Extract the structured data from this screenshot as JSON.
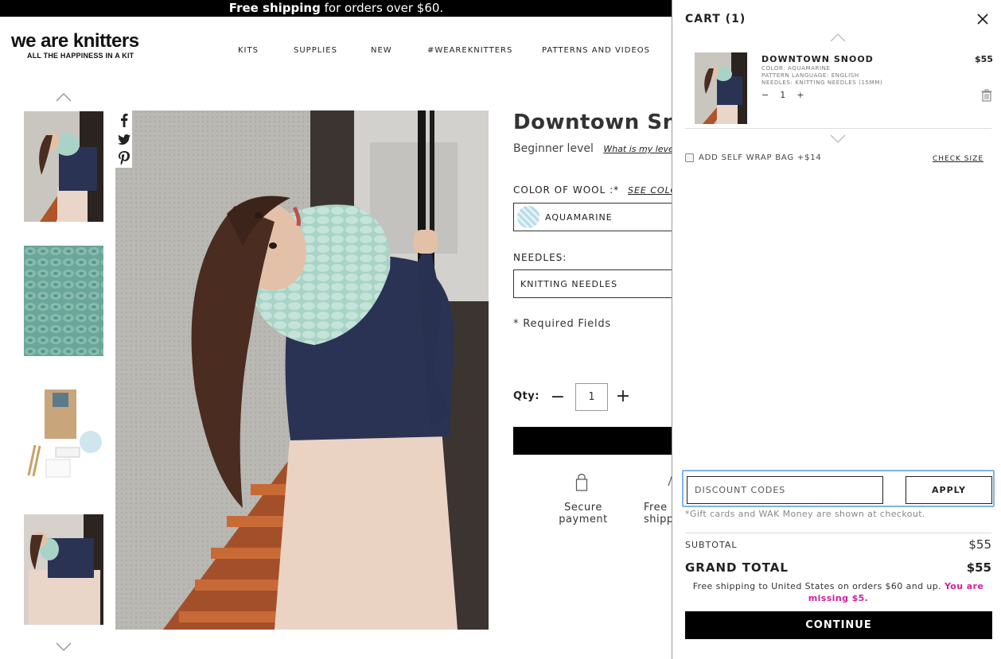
{
  "topbar": {
    "bold": "Free shipping",
    "rest": " for orders over $60."
  },
  "logo": {
    "main": "we are knitters",
    "tagline": "ALL THE HAPPINESS IN A KIT"
  },
  "nav": {
    "items": [
      "KITS",
      "SUPPLIES",
      "NEW",
      "#WEAREKNITTERS",
      "PATTERNS AND VIDEOS"
    ]
  },
  "product": {
    "title": "Downtown Snood",
    "level": "Beginner level",
    "level_link": "What is my level?",
    "color_label": "COLOR OF WOOL :*",
    "color_link": "SEE COLORS",
    "color_value": "AQUAMARINE",
    "needles_label": "NEEDLES:",
    "needles_value": "KNITTING NEEDLES",
    "required": "* Required Fields",
    "qty_label": "Qty:",
    "qty_value": "1",
    "feature1": "Secure payment",
    "feature2": "Free shipping +"
  },
  "cart": {
    "title": "CART (1)",
    "item": {
      "name": "DOWNTOWN SNOOD",
      "color": "COLOR: AQUAMARINE",
      "language": "PATTERN LANGUAGE: ENGLISH",
      "needles": "NEEDLES: KNITTING NEEDLES (15MM)",
      "price": "$55",
      "qty": "1"
    },
    "wrap_label": "ADD SELF WRAP BAG +$14",
    "check_size": "CHECK SIZE",
    "discount_placeholder": "DISCOUNT CODES",
    "apply": "APPLY",
    "gift_note": "*Gift cards and WAK Money are shown at checkout.",
    "subtotal_label": "SUBTOTAL",
    "subtotal_value": "$55",
    "grand_label": "GRAND TOTAL",
    "grand_value": "$55",
    "ship_note": "Free shipping to United States on orders $60 and up.",
    "ship_missing": "You are missing $5.",
    "continue": "CONTINUE"
  },
  "colors": {
    "accent_pink": "#d01e9c",
    "focus_blue": "#7eb4ea",
    "snood": "#a9d3c6"
  }
}
